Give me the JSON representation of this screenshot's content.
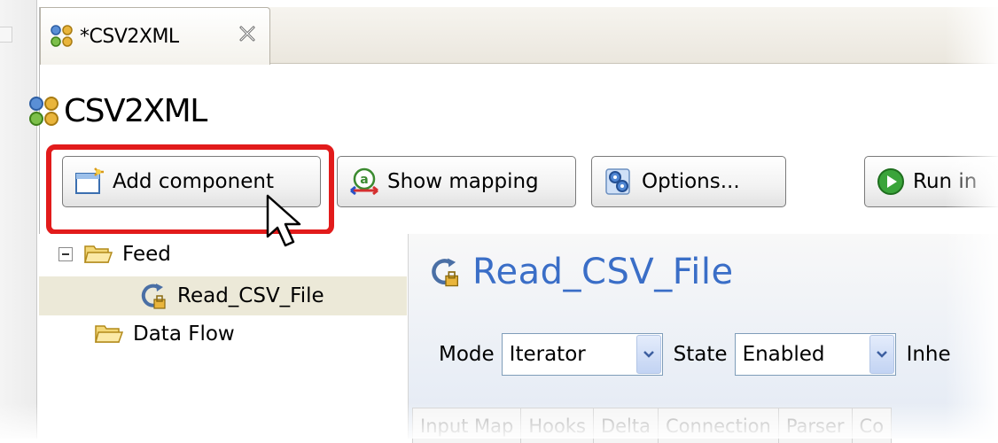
{
  "editor_tab": {
    "label": "*CSV2XML"
  },
  "header": {
    "title": "CSV2XML"
  },
  "toolbar": {
    "add_component": "Add component",
    "show_mapping": "Show mapping",
    "options": "Options...",
    "run": "Run in"
  },
  "tree": {
    "items": [
      {
        "label": "Feed"
      },
      {
        "label": "Read_CSV_File"
      },
      {
        "label": "Data Flow"
      }
    ]
  },
  "details": {
    "title": "Read_CSV_File",
    "mode_label": "Mode",
    "mode_value": "Iterator",
    "state_label": "State",
    "state_value": "Enabled",
    "inherit_label": "Inhe",
    "tabs": [
      "Input Map",
      "Hooks",
      "Delta",
      "Connection",
      "Parser",
      "Co"
    ]
  },
  "colors": {
    "highlight": "#e21b1b",
    "title_blue": "#3a6ec7",
    "selection": "#ece9d8"
  }
}
